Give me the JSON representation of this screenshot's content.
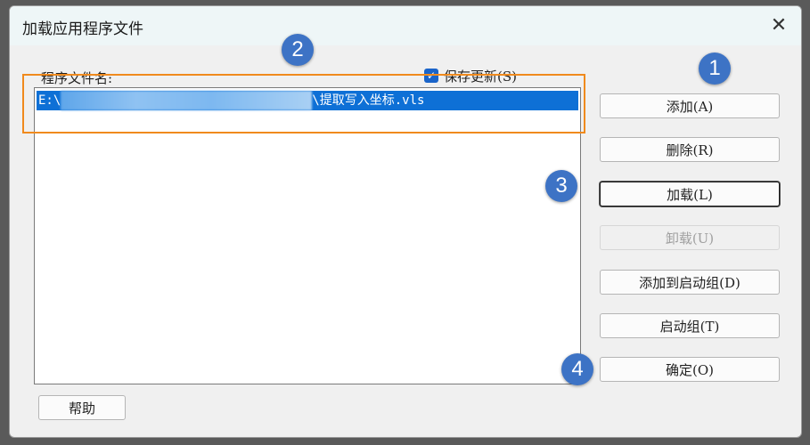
{
  "window": {
    "title": "加载应用程序文件",
    "close_glyph": "✕"
  },
  "list": {
    "label": "程序文件名:",
    "items": [
      {
        "prefix": "E:\\",
        "suffix": "\\提取写入坐标.vls"
      }
    ]
  },
  "save_updates": {
    "label": "保存更新(S)",
    "checked": true
  },
  "buttons": {
    "add": "添加(A)",
    "remove": "删除(R)",
    "load": "加载(L)",
    "unload": "卸载(U)",
    "add_startup": "添加到启动组(D)",
    "startup_group": "启动组(T)",
    "ok": "确定(O)",
    "help": "帮助"
  },
  "badges": [
    "1",
    "2",
    "3",
    "4"
  ],
  "colors": {
    "selection": "#0e70d6",
    "highlight": "#f08a1d",
    "badge": "#3d73c5"
  }
}
